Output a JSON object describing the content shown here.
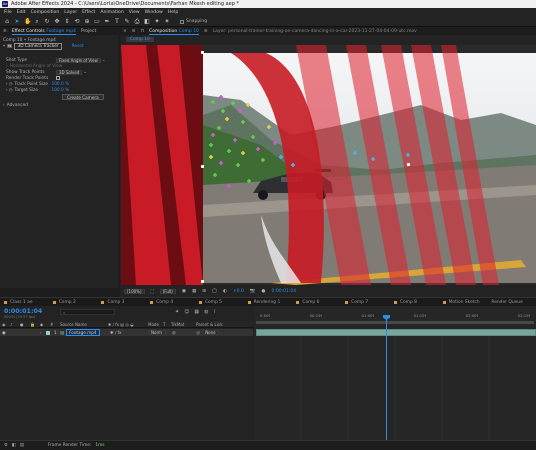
{
  "window": {
    "title": "Adobe After Effects 2024 - C:\\Users\\Lorta\\OneDrive\\Documents\\Farhan Mkesh editing aep *"
  },
  "menu": [
    "File",
    "Edit",
    "Composition",
    "Layer",
    "Effect",
    "Animation",
    "View",
    "Window",
    "Help"
  ],
  "toolbar": {
    "snapping_label": "Snapping"
  },
  "effect_controls": {
    "tabs": [
      "Effect Controls",
      "Footage mp4",
      "Project"
    ],
    "breadcrumb": "Comp 10 • Footage.mp4",
    "effect_name": "3D Camera Tracker",
    "reset_label": "Reset",
    "rows": [
      {
        "label": "Shot Type",
        "value": "Fixed Angle of View"
      },
      {
        "label": "Horizontal Angle of View",
        "value": ""
      },
      {
        "label": "Show Track Points",
        "value": "3D Solved"
      },
      {
        "label": "Render Track Points",
        "value": ""
      },
      {
        "label": "Track Point Size",
        "value": "100.0 %"
      },
      {
        "label": "Target Size",
        "value": "100.0 %"
      }
    ],
    "create_camera_label": "Create Camera",
    "advanced_label": "Advanced"
  },
  "viewer": {
    "tab_label": "Composition",
    "comp_name": "Comp 10",
    "layer_label": "Layer: personal-trainer-training-on-camera-dancing-in-a-car-2023-11-27-04-04-09-utc.mov",
    "sub_tab": "Comp 10",
    "footer": {
      "zoom": "(100%)",
      "resolution": "(Full)",
      "exposure": "+0.0",
      "timecode": "0:00:01:04"
    }
  },
  "timeline": {
    "tabs": [
      "Class 1 ae",
      "Comp 2",
      "Comp 3",
      "Comp 4",
      "Comp 5",
      "Rendering 1",
      "Comp 6",
      "Comp 7",
      "Comp 8",
      "Motion Sketch",
      "Render Queue",
      "Comp 11"
    ],
    "timecode": "0:00:01:04",
    "timecode_sub": "00034 (29.97 fps)",
    "columns": [
      "Source Name",
      "Mode",
      "T",
      "TrkMat",
      "Parent & Link"
    ],
    "layer": {
      "index": "1",
      "name": "Footage.mp4",
      "mode": "Norm",
      "parent": "None"
    },
    "ruler_marks": [
      "0:00f",
      "00:15f",
      "01:00f",
      "01:15f",
      "02:00f",
      "02:15f"
    ],
    "playhead_position": 0.47
  },
  "status_bar": {
    "label": "Frame Render Time:",
    "value": "1ms"
  },
  "colors": {
    "accent": "#2d8ceb",
    "layer_bar": "#7aa59a",
    "tab_marker": "#c8a14a"
  }
}
